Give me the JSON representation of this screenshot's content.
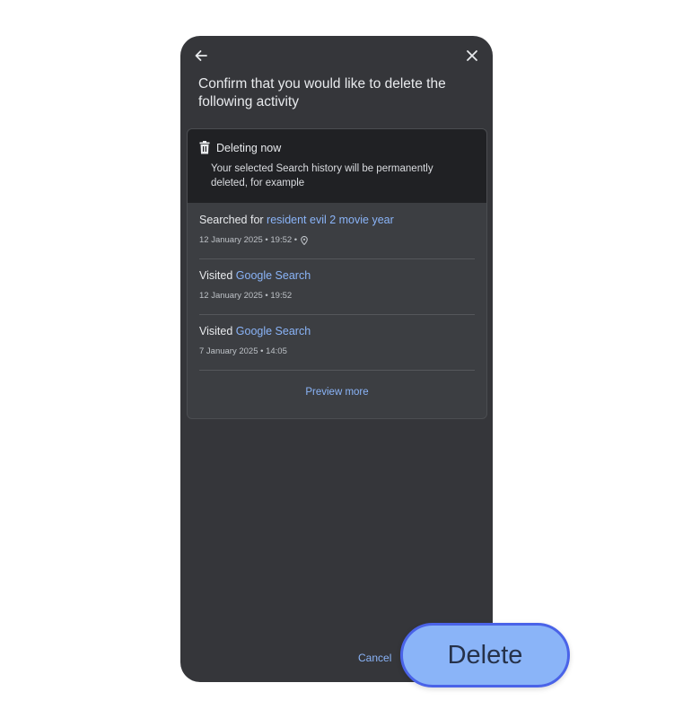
{
  "dialog": {
    "title": "Confirm that you would like to delete the following activity",
    "back_icon": "arrow-left-icon",
    "close_icon": "close-icon"
  },
  "summary": {
    "icon": "trash-icon",
    "heading": "Deleting now",
    "description": "Your selected Search history will be permanently deleted, for example"
  },
  "items": [
    {
      "prefix": "Searched for ",
      "link": "resident evil 2 movie year",
      "meta": "12 January 2025 • 19:52 •",
      "has_location": true
    },
    {
      "prefix": "Visited ",
      "link": "Google Search",
      "meta": "12 January 2025 • 19:52",
      "has_location": false
    },
    {
      "prefix": "Visited ",
      "link": "Google Search",
      "meta": "7 January 2025 • 14:05",
      "has_location": false
    }
  ],
  "preview_more_label": "Preview more",
  "actions": {
    "cancel_label": "Cancel",
    "delete_label": "Delete"
  },
  "colors": {
    "background": "#35363a",
    "accent": "#8ab4f8",
    "header": "#202124"
  }
}
